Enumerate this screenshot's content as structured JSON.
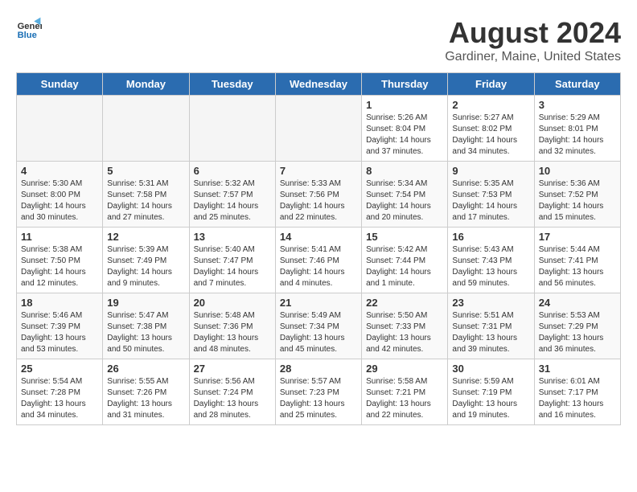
{
  "header": {
    "logo_line1": "General",
    "logo_line2": "Blue",
    "title": "August 2024",
    "subtitle": "Gardiner, Maine, United States"
  },
  "days_of_week": [
    "Sunday",
    "Monday",
    "Tuesday",
    "Wednesday",
    "Thursday",
    "Friday",
    "Saturday"
  ],
  "weeks": [
    [
      {
        "day": "",
        "empty": true
      },
      {
        "day": "",
        "empty": true
      },
      {
        "day": "",
        "empty": true
      },
      {
        "day": "",
        "empty": true
      },
      {
        "day": "1",
        "sunrise": "5:26 AM",
        "sunset": "8:04 PM",
        "daylight": "14 hours and 37 minutes."
      },
      {
        "day": "2",
        "sunrise": "5:27 AM",
        "sunset": "8:02 PM",
        "daylight": "14 hours and 34 minutes."
      },
      {
        "day": "3",
        "sunrise": "5:29 AM",
        "sunset": "8:01 PM",
        "daylight": "14 hours and 32 minutes."
      }
    ],
    [
      {
        "day": "4",
        "sunrise": "5:30 AM",
        "sunset": "8:00 PM",
        "daylight": "14 hours and 30 minutes."
      },
      {
        "day": "5",
        "sunrise": "5:31 AM",
        "sunset": "7:58 PM",
        "daylight": "14 hours and 27 minutes."
      },
      {
        "day": "6",
        "sunrise": "5:32 AM",
        "sunset": "7:57 PM",
        "daylight": "14 hours and 25 minutes."
      },
      {
        "day": "7",
        "sunrise": "5:33 AM",
        "sunset": "7:56 PM",
        "daylight": "14 hours and 22 minutes."
      },
      {
        "day": "8",
        "sunrise": "5:34 AM",
        "sunset": "7:54 PM",
        "daylight": "14 hours and 20 minutes."
      },
      {
        "day": "9",
        "sunrise": "5:35 AM",
        "sunset": "7:53 PM",
        "daylight": "14 hours and 17 minutes."
      },
      {
        "day": "10",
        "sunrise": "5:36 AM",
        "sunset": "7:52 PM",
        "daylight": "14 hours and 15 minutes."
      }
    ],
    [
      {
        "day": "11",
        "sunrise": "5:38 AM",
        "sunset": "7:50 PM",
        "daylight": "14 hours and 12 minutes."
      },
      {
        "day": "12",
        "sunrise": "5:39 AM",
        "sunset": "7:49 PM",
        "daylight": "14 hours and 9 minutes."
      },
      {
        "day": "13",
        "sunrise": "5:40 AM",
        "sunset": "7:47 PM",
        "daylight": "14 hours and 7 minutes."
      },
      {
        "day": "14",
        "sunrise": "5:41 AM",
        "sunset": "7:46 PM",
        "daylight": "14 hours and 4 minutes."
      },
      {
        "day": "15",
        "sunrise": "5:42 AM",
        "sunset": "7:44 PM",
        "daylight": "14 hours and 1 minute."
      },
      {
        "day": "16",
        "sunrise": "5:43 AM",
        "sunset": "7:43 PM",
        "daylight": "13 hours and 59 minutes."
      },
      {
        "day": "17",
        "sunrise": "5:44 AM",
        "sunset": "7:41 PM",
        "daylight": "13 hours and 56 minutes."
      }
    ],
    [
      {
        "day": "18",
        "sunrise": "5:46 AM",
        "sunset": "7:39 PM",
        "daylight": "13 hours and 53 minutes."
      },
      {
        "day": "19",
        "sunrise": "5:47 AM",
        "sunset": "7:38 PM",
        "daylight": "13 hours and 50 minutes."
      },
      {
        "day": "20",
        "sunrise": "5:48 AM",
        "sunset": "7:36 PM",
        "daylight": "13 hours and 48 minutes."
      },
      {
        "day": "21",
        "sunrise": "5:49 AM",
        "sunset": "7:34 PM",
        "daylight": "13 hours and 45 minutes."
      },
      {
        "day": "22",
        "sunrise": "5:50 AM",
        "sunset": "7:33 PM",
        "daylight": "13 hours and 42 minutes."
      },
      {
        "day": "23",
        "sunrise": "5:51 AM",
        "sunset": "7:31 PM",
        "daylight": "13 hours and 39 minutes."
      },
      {
        "day": "24",
        "sunrise": "5:53 AM",
        "sunset": "7:29 PM",
        "daylight": "13 hours and 36 minutes."
      }
    ],
    [
      {
        "day": "25",
        "sunrise": "5:54 AM",
        "sunset": "7:28 PM",
        "daylight": "13 hours and 34 minutes."
      },
      {
        "day": "26",
        "sunrise": "5:55 AM",
        "sunset": "7:26 PM",
        "daylight": "13 hours and 31 minutes."
      },
      {
        "day": "27",
        "sunrise": "5:56 AM",
        "sunset": "7:24 PM",
        "daylight": "13 hours and 28 minutes."
      },
      {
        "day": "28",
        "sunrise": "5:57 AM",
        "sunset": "7:23 PM",
        "daylight": "13 hours and 25 minutes."
      },
      {
        "day": "29",
        "sunrise": "5:58 AM",
        "sunset": "7:21 PM",
        "daylight": "13 hours and 22 minutes."
      },
      {
        "day": "30",
        "sunrise": "5:59 AM",
        "sunset": "7:19 PM",
        "daylight": "13 hours and 19 minutes."
      },
      {
        "day": "31",
        "sunrise": "6:01 AM",
        "sunset": "7:17 PM",
        "daylight": "13 hours and 16 minutes."
      }
    ]
  ]
}
